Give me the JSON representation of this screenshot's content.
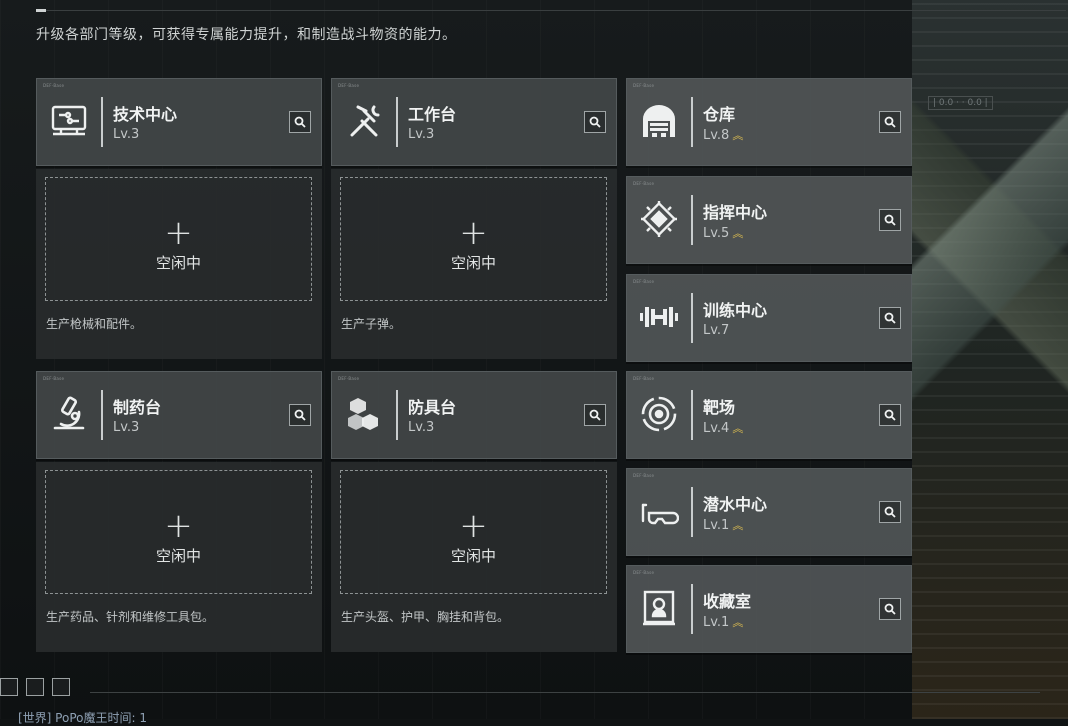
{
  "header": {
    "subtitle": "升级各部门等级，可获得专属能力提升，和制造战斗物资的能力。"
  },
  "production_facilities": [
    {
      "name": "技术中心",
      "level": "Lv.3",
      "slot_label": "空闲中",
      "description": "生产枪械和配件。",
      "icon": "computer-icon"
    },
    {
      "name": "工作台",
      "level": "Lv.3",
      "slot_label": "空闲中",
      "description": "生产子弹。",
      "icon": "tools-icon"
    },
    {
      "name": "制药台",
      "level": "Lv.3",
      "slot_label": "空闲中",
      "description": "生产药品、针剂和维修工具包。",
      "icon": "microscope-icon"
    },
    {
      "name": "防具台",
      "level": "Lv.3",
      "slot_label": "空闲中",
      "description": "生产头盔、护甲、胸挂和背包。",
      "icon": "cubes-icon"
    }
  ],
  "facilities": [
    {
      "name": "仓库",
      "level": "Lv.8",
      "upgradable": true,
      "icon": "warehouse-icon"
    },
    {
      "name": "指挥中心",
      "level": "Lv.5",
      "upgradable": true,
      "icon": "chip-icon"
    },
    {
      "name": "训练中心",
      "level": "Lv.7",
      "upgradable": false,
      "icon": "dumbbell-icon"
    },
    {
      "name": "靶场",
      "level": "Lv.4",
      "upgradable": true,
      "icon": "target-icon"
    },
    {
      "name": "潜水中心",
      "level": "Lv.1",
      "upgradable": true,
      "icon": "diving-mask-icon"
    },
    {
      "name": "收藏室",
      "level": "Lv.1",
      "upgradable": true,
      "icon": "collection-icon"
    }
  ],
  "chat": {
    "text": "[世界] PoPo魔王时间: 1"
  },
  "colors": {
    "upgrade_chevron": "#e3c250",
    "card_bg": "#42464a",
    "panel_bg": "#282b2d"
  }
}
